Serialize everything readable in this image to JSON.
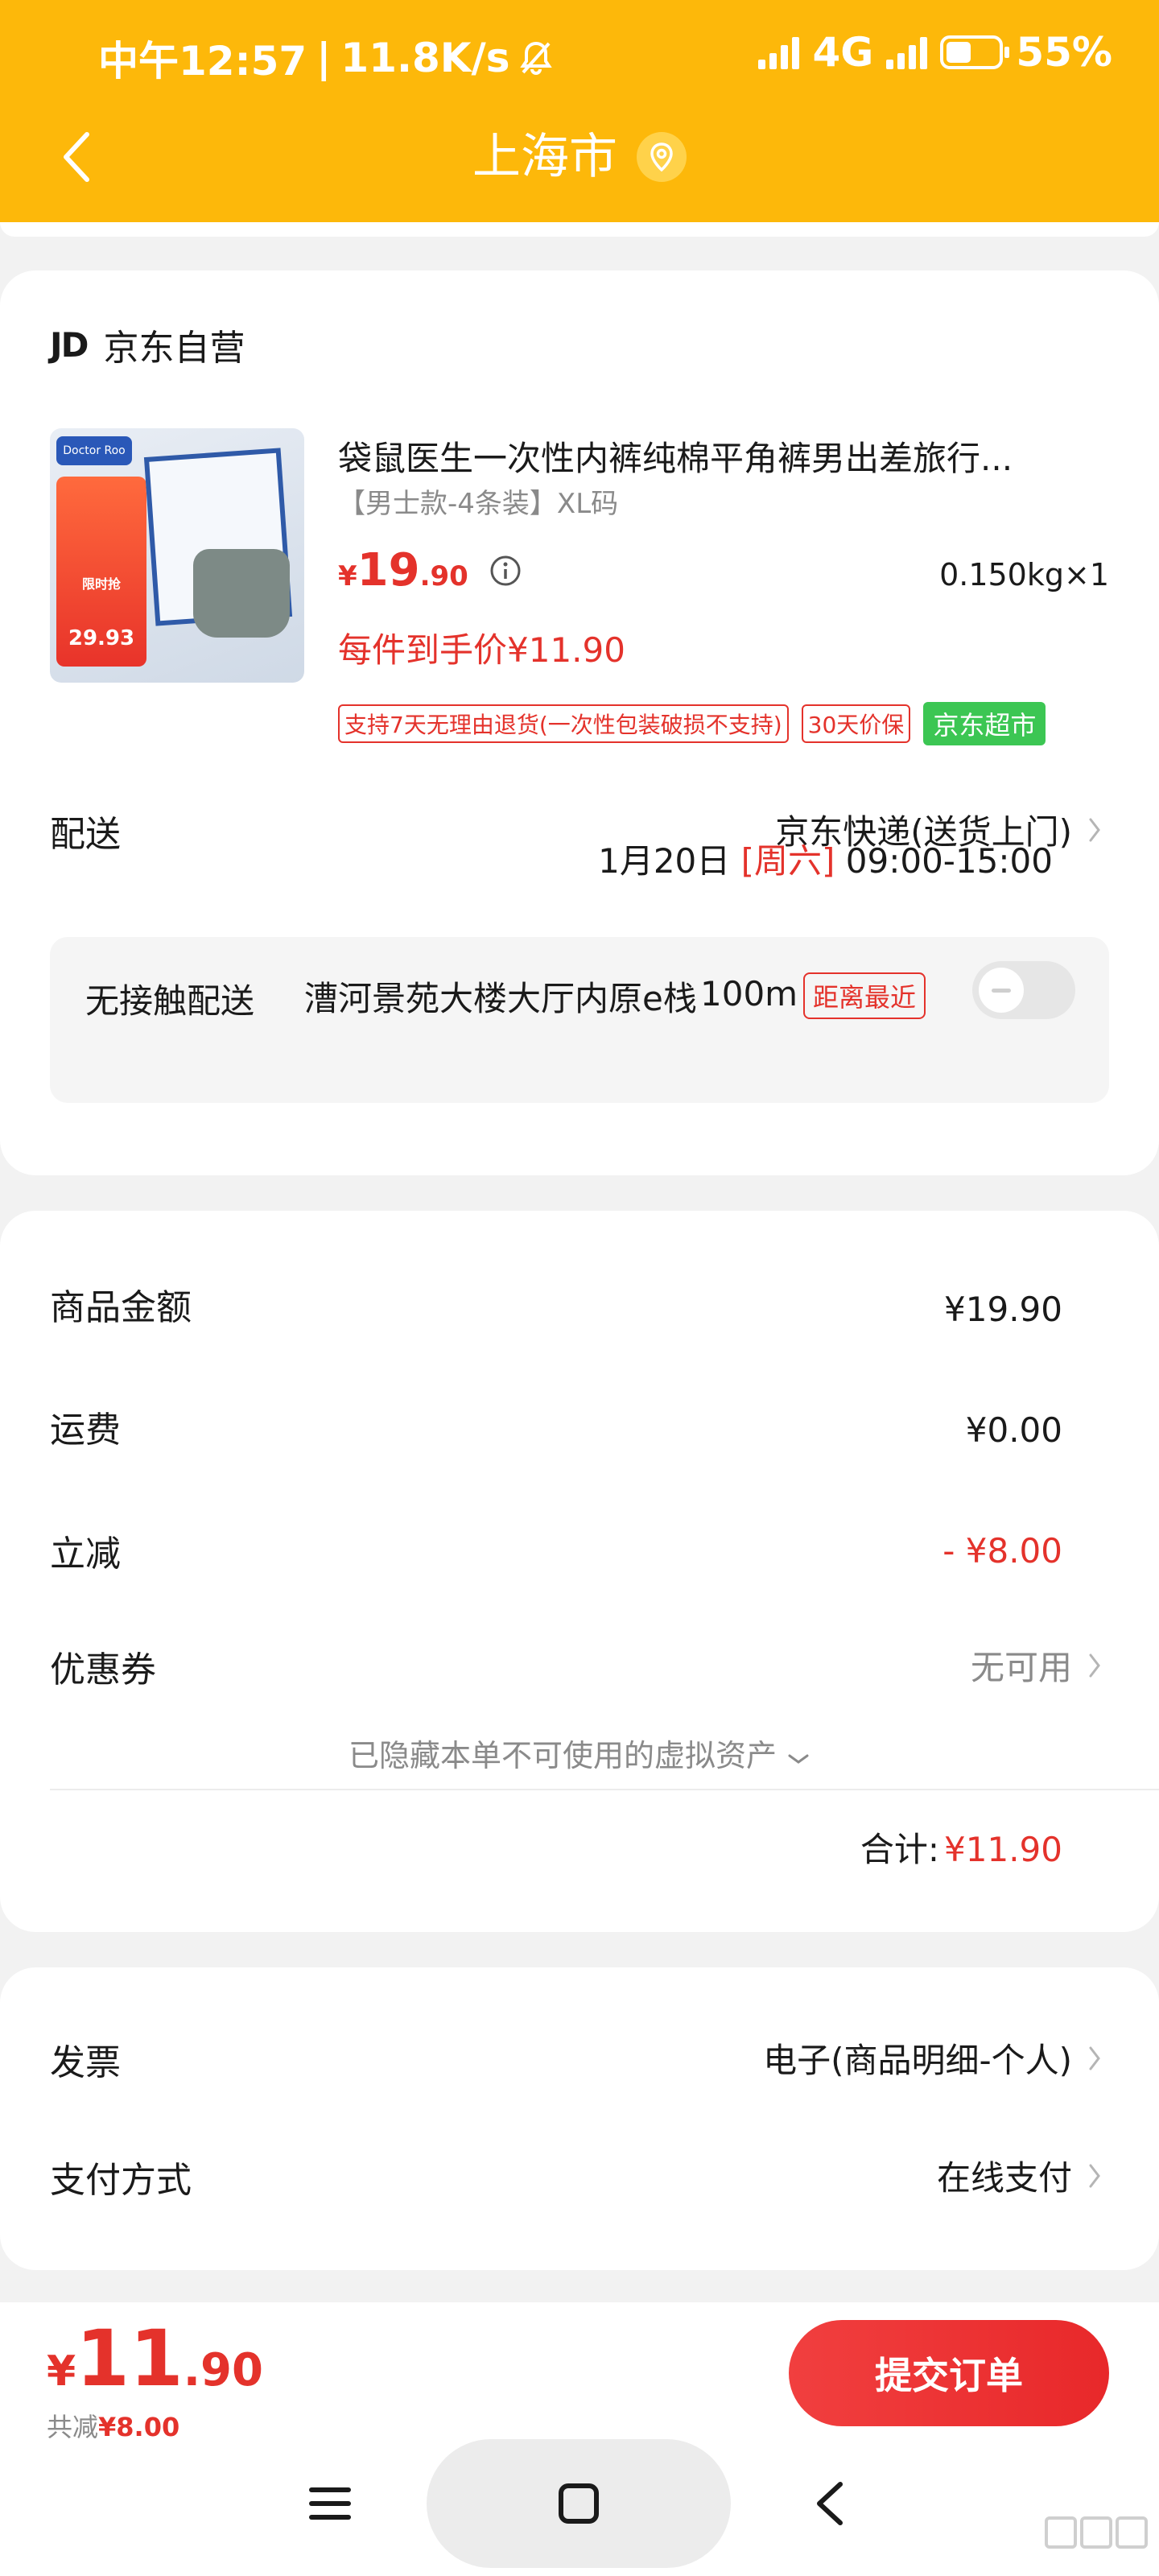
{
  "status_bar": {
    "time": "中午12:57",
    "net_speed": "11.8K/s",
    "network": "4G",
    "battery": "55%"
  },
  "header": {
    "title": "上海市"
  },
  "shop": {
    "logo": "JD",
    "name": "京东自营"
  },
  "product": {
    "title": "袋鼠医生一次性内裤纯棉平角裤男出差旅行...",
    "spec": "【男士款-4条装】XL码",
    "price_symbol": "¥",
    "price_int": "19",
    "price_dec": ".90",
    "weight": "0.150kg×1",
    "unit_price": "每件到手价¥11.90",
    "tags": [
      "支持7天无理由退货(一次性包装破损不支持)",
      "30天价保"
    ],
    "tag_green": "京东超市",
    "image": {
      "brand": "Doctor Roo",
      "promo_line": "限时抢",
      "promo_price": "29.93"
    }
  },
  "delivery": {
    "label": "配送",
    "method": "京东快递(送货上门)",
    "date": "1月20日",
    "day": "[周六]",
    "time": "09:00-15:00"
  },
  "contactless": {
    "label": "无接触配送",
    "address": "漕河景苑大楼大厅内原e栈",
    "distance": "100m",
    "badge": "距离最近",
    "enabled": false
  },
  "summary": {
    "goods_label": "商品金额",
    "goods_value": "¥19.90",
    "shipping_label": "运费",
    "shipping_value": "¥0.00",
    "discount_label": "立减",
    "discount_value": "- ¥8.00",
    "coupon_label": "优惠券",
    "coupon_value": "无可用",
    "hidden_assets": "已隐藏本单不可使用的虚拟资产",
    "total_label": "合计:",
    "total_value": "¥11.90"
  },
  "extra": {
    "invoice_label": "发票",
    "invoice_value": "电子(商品明细-个人)",
    "payment_label": "支付方式",
    "payment_value": "在线支付"
  },
  "bottom": {
    "price_symbol": "¥",
    "price_int": "11",
    "price_dec": ".90",
    "saved_label": "共减",
    "saved_value": "¥8.00",
    "submit_label": "提交订单"
  },
  "colors": {
    "header": "#fdb80a",
    "accent_red": "#e4322b",
    "green_tag": "#3cc653"
  }
}
